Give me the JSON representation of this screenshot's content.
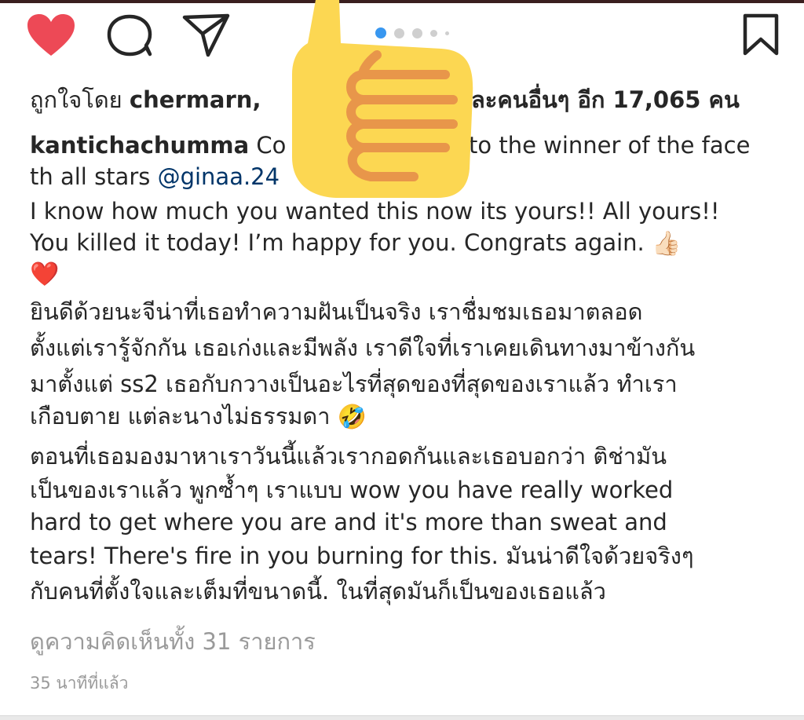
{
  "actions": {
    "like_color": "#ed4956",
    "icons": [
      "heart-icon",
      "comment-icon",
      "share-icon",
      "bookmark-icon"
    ]
  },
  "carousel": {
    "dot_count": 5,
    "active_index": 0,
    "active_color": "#3897f0"
  },
  "likes": {
    "prefix": "ถูกใจโดย ",
    "first_user": "chermarn",
    "separator": ",",
    "hidden_gap": "",
    "suffix": "ละคนอื่นๆ อีก 17,065 คน"
  },
  "caption": {
    "username": "kanticha­chumma",
    "line1_text": " Co",
    "line1_tail": "to the winner of the face",
    "line2_text": "th all stars ",
    "line2_mention": "@ginaa.24",
    "line3": "I know how much you wanted this now its yours!! All yours!!",
    "line4": "You killed it today! I’m happy for you. Congrats again.",
    "line4_emoji": "👍🏻",
    "line5_emoji": "❤️",
    "line6": "ยินดีด้วยนะจีน่าที่เธอทำความฝันเป็นจริง เราชื่มชมเธอมาตลอด",
    "line7": "ตั้งแต่เรารู้จักกัน เธอเก่งและมีพลัง เราดีใจที่เราเคยเดินทางมาข้างกัน",
    "line8": "มาตั้งแต่ ss2 เธอกับกวางเป็นอะไรที่สุดของที่สุดของเราแล้ว ทำเรา",
    "line9": "เกือบตาย แต่ละนางไม่ธรรมดา",
    "line9_emoji": "🤣",
    "line10": " ตอนที่เธอมองมาหาเราวันนี้แล้วเรากอดกันและเธอบอกว่า ติช่ามัน",
    "line11": "เป็นของเราแล้ว พูกซ้ำๆ เราแบบ wow you have really worked",
    "line12": "hard to get where you are and it's more than sweat and",
    "line13": "tears!  There's fire in you burning for this. มันน่าดีใจด้วยจริงๆ",
    "line14": "กับคนที่ตั้งใจและเต็มที่ขนาดนี้. ในที่สุดมันก็เป็นของเธอแล้ว"
  },
  "comments": {
    "view_all": "ดูความคิดเห็นทั้ง 31 รายการ"
  },
  "meta": {
    "time_ago": "35 นาทีที่แล้ว"
  },
  "overlay": {
    "emoji_name": "thumbs-up-sticker",
    "fill_color": "#fcd752",
    "line_color": "#e8964a"
  }
}
